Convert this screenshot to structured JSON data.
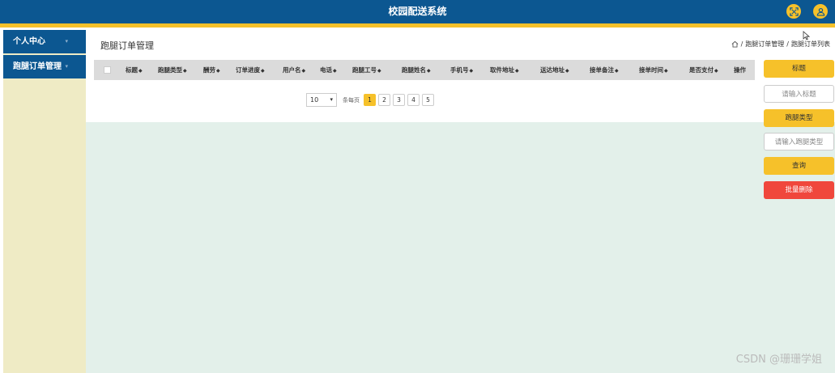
{
  "app": {
    "title": "校园配送系统"
  },
  "header_icons": {
    "fullscreen": "expand-icon",
    "user": "user-icon"
  },
  "sidebar": {
    "items": [
      {
        "label": "个人中心"
      },
      {
        "label": "跑腿订单管理"
      }
    ]
  },
  "page": {
    "title": "跑腿订单管理",
    "breadcrumb": [
      "跑腿订单管理",
      "跑腿订单列表"
    ],
    "breadcrumb_sep": "/"
  },
  "table": {
    "columns": [
      "标题",
      "跑腿类型",
      "酬劳",
      "订单进度",
      "用户名",
      "电话",
      "跑腿工号",
      "跑腿姓名",
      "手机号",
      "取件地址",
      "送达地址",
      "接单备注",
      "接单时间",
      "是否支付",
      "操作"
    ]
  },
  "pagination": {
    "page_size": "10",
    "per_page_label": "条每页",
    "pages": [
      "1",
      "2",
      "3",
      "4",
      "5"
    ],
    "current": "1"
  },
  "search": {
    "title_label": "标题",
    "title_placeholder": "请输入标题",
    "type_label": "跑腿类型",
    "type_placeholder": "请输入跑腿类型",
    "query_button": "查询",
    "batch_delete_button": "批量删除"
  },
  "watermark": "CSDN @珊珊学姐",
  "colors": {
    "primary": "#0c5791",
    "accent": "#f6c12a",
    "danger": "#f0473c",
    "sidebar_bg": "#efebc5",
    "content_bg": "#e3f0ea"
  }
}
